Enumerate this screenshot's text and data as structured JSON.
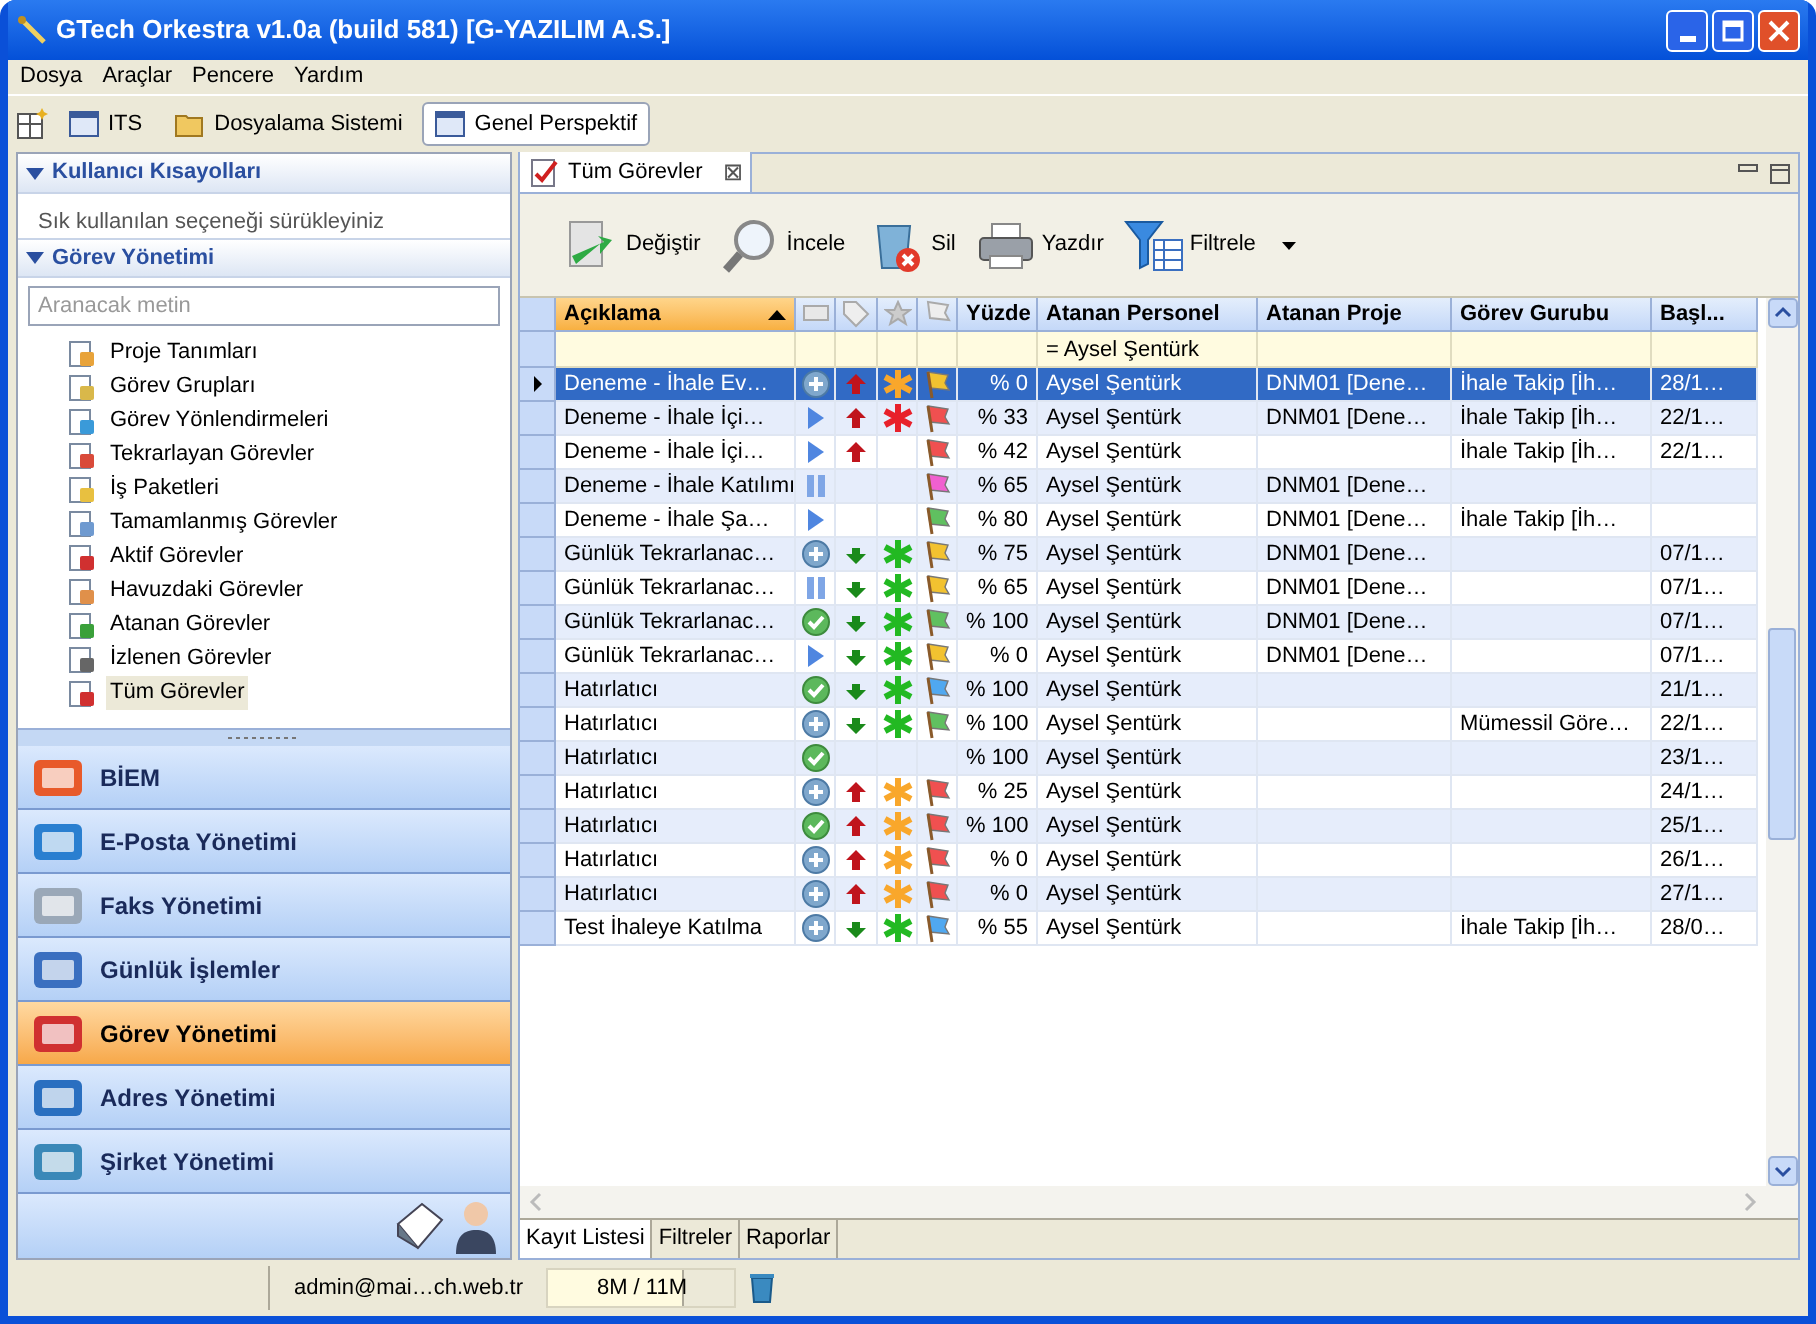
{
  "window": {
    "title": "GTech Orkestra v1.0a (build 581) [G-YAZILIM A.S.]"
  },
  "menu": [
    "Dosya",
    "Araçlar",
    "Pencere",
    "Yardım"
  ],
  "perspectives": [
    {
      "label": "ITS",
      "selected": false
    },
    {
      "label": "Dosyalama Sistemi",
      "selected": false
    },
    {
      "label": "Genel Perspektif",
      "selected": true
    }
  ],
  "sidebar": {
    "shortcuts_title": "Kullanıcı Kısayolları",
    "shortcuts_hint": "Sık kullanılan seçeneği sürükleyiniz",
    "section_title": "Görev Yönetimi",
    "search": {
      "placeholder": "Aranacak metin"
    },
    "items": [
      {
        "label": "Proje Tanımları",
        "selected": false
      },
      {
        "label": "Görev Grupları",
        "selected": false
      },
      {
        "label": "Görev Yönlendirmeleri",
        "selected": false
      },
      {
        "label": "Tekrarlayan Görevler",
        "selected": false
      },
      {
        "label": "İş Paketleri",
        "selected": false
      },
      {
        "label": "Tamamlanmış Görevler",
        "selected": false
      },
      {
        "label": "Aktif Görevler",
        "selected": false
      },
      {
        "label": "Havuzdaki Görevler",
        "selected": false
      },
      {
        "label": "Atanan Görevler",
        "selected": false
      },
      {
        "label": "İzlenen Görevler",
        "selected": false
      },
      {
        "label": "Tüm Görevler",
        "selected": true
      }
    ],
    "modules": [
      {
        "label": "BİEM",
        "selected": false
      },
      {
        "label": "E-Posta Yönetimi",
        "selected": false
      },
      {
        "label": "Faks Yönetimi",
        "selected": false
      },
      {
        "label": "Günlük İşlemler",
        "selected": false
      },
      {
        "label": "Görev Yönetimi",
        "selected": true
      },
      {
        "label": "Adres Yönetimi",
        "selected": false
      },
      {
        "label": "Şirket Yönetimi",
        "selected": false
      }
    ]
  },
  "editor_tab": {
    "title": "Tüm Görevler",
    "close": "⊠"
  },
  "toolbar": [
    {
      "label": "Değiştir",
      "dropdown": false
    },
    {
      "label": "İncele",
      "dropdown": false
    },
    {
      "label": "Sil",
      "dropdown": false
    },
    {
      "label": "Yazdır",
      "dropdown": false
    },
    {
      "label": "Filtrele",
      "dropdown": true
    }
  ],
  "table": {
    "columns": [
      {
        "kind": "text",
        "label": "Açıklama",
        "sorted": true
      },
      {
        "kind": "icon"
      },
      {
        "kind": "icon"
      },
      {
        "kind": "icon"
      },
      {
        "kind": "icon"
      },
      {
        "kind": "text",
        "label": "Yüzde"
      },
      {
        "kind": "text",
        "label": "Atanan Personel",
        "filter": "= Aysel Şentürk"
      },
      {
        "kind": "text",
        "label": "Atanan Proje"
      },
      {
        "kind": "text",
        "label": "Görev Gurubu"
      },
      {
        "kind": "text",
        "label": "Başl..."
      }
    ],
    "rows": [
      {
        "selected": true,
        "desc": "Deneme - İhale Ev…",
        "status": {
          "kind": "new"
        },
        "priority": {
          "kind": "up"
        },
        "importance": {
          "color": "#f9a72b"
        },
        "flag": {
          "color": "#f2c230"
        },
        "percent": "% 0",
        "person": "Aysel Şentürk",
        "project": "DNM01 [Dene…",
        "group": "İhale Takip [İh…",
        "start": "28/1…"
      },
      {
        "selected": false,
        "desc": "Deneme - İhale İçi…",
        "status": {
          "kind": "running"
        },
        "priority": {
          "kind": "up"
        },
        "importance": {
          "color": "#e8202a"
        },
        "flag": {
          "color": "#f05050"
        },
        "percent": "% 33",
        "person": "Aysel Şentürk",
        "project": "DNM01 [Dene…",
        "group": "İhale Takip [İh…",
        "start": "22/1…"
      },
      {
        "selected": false,
        "desc": "Deneme - İhale İçi…",
        "status": {
          "kind": "running"
        },
        "priority": {
          "kind": "up"
        },
        "flag": {
          "color": "#f05050"
        },
        "percent": "% 42",
        "person": "Aysel Şentürk",
        "group": "İhale Takip [İh…",
        "start": "22/1…"
      },
      {
        "selected": false,
        "desc": "Deneme - İhale Katılımı",
        "status": {
          "kind": "paused"
        },
        "flag": {
          "color": "#f060d0"
        },
        "percent": "% 65",
        "person": "Aysel Şentürk",
        "project": "DNM01 [Dene…"
      },
      {
        "selected": false,
        "desc": "Deneme - İhale Şa…",
        "status": {
          "kind": "running"
        },
        "flag": {
          "color": "#60c060"
        },
        "percent": "% 80",
        "person": "Aysel Şentürk",
        "project": "DNM01 [Dene…",
        "group": "İhale Takip [İh…"
      },
      {
        "selected": false,
        "desc": "Günlük Tekrarlanac…",
        "status": {
          "kind": "new"
        },
        "priority": {
          "kind": "down"
        },
        "importance": {
          "color": "#22b922"
        },
        "flag": {
          "color": "#f2c230"
        },
        "percent": "% 75",
        "person": "Aysel Şentürk",
        "project": "DNM01 [Dene…",
        "start": "07/1…"
      },
      {
        "selected": false,
        "desc": "Günlük Tekrarlanac…",
        "status": {
          "kind": "paused"
        },
        "priority": {
          "kind": "down"
        },
        "importance": {
          "color": "#22b922"
        },
        "flag": {
          "color": "#f2c230"
        },
        "percent": "% 65",
        "person": "Aysel Şentürk",
        "project": "DNM01 [Dene…",
        "start": "07/1…"
      },
      {
        "selected": false,
        "desc": "Günlük Tekrarlanac…",
        "status": {
          "kind": "done"
        },
        "priority": {
          "kind": "down"
        },
        "importance": {
          "color": "#22b922"
        },
        "flag": {
          "color": "#60c060"
        },
        "percent": "% 100",
        "person": "Aysel Şentürk",
        "project": "DNM01 [Dene…",
        "start": "07/1…"
      },
      {
        "selected": false,
        "desc": "Günlük Tekrarlanac…",
        "status": {
          "kind": "running"
        },
        "priority": {
          "kind": "down"
        },
        "importance": {
          "color": "#22b922"
        },
        "flag": {
          "color": "#f2c230"
        },
        "percent": "% 0",
        "person": "Aysel Şentürk",
        "project": "DNM01 [Dene…",
        "start": "07/1…"
      },
      {
        "selected": false,
        "desc": "Hatırlatıcı",
        "status": {
          "kind": "done"
        },
        "priority": {
          "kind": "down"
        },
        "importance": {
          "color": "#22b922"
        },
        "flag": {
          "color": "#50a8f0"
        },
        "percent": "% 100",
        "person": "Aysel Şentürk",
        "start": "21/1…"
      },
      {
        "selected": false,
        "desc": "Hatırlatıcı",
        "status": {
          "kind": "new"
        },
        "priority": {
          "kind": "down"
        },
        "importance": {
          "color": "#22b922"
        },
        "flag": {
          "color": "#60c060"
        },
        "percent": "% 100",
        "person": "Aysel Şentürk",
        "group": "Mümessil Göre…",
        "start": "22/1…"
      },
      {
        "selected": false,
        "desc": "Hatırlatıcı",
        "status": {
          "kind": "done"
        },
        "percent": "% 100",
        "person": "Aysel Şentürk",
        "start": "23/1…"
      },
      {
        "selected": false,
        "desc": "Hatırlatıcı",
        "status": {
          "kind": "new"
        },
        "priority": {
          "kind": "up"
        },
        "importance": {
          "color": "#f9a72b"
        },
        "flag": {
          "color": "#f05050"
        },
        "percent": "% 25",
        "person": "Aysel Şentürk",
        "start": "24/1…"
      },
      {
        "selected": false,
        "desc": "Hatırlatıcı",
        "status": {
          "kind": "done"
        },
        "priority": {
          "kind": "up"
        },
        "importance": {
          "color": "#f9a72b"
        },
        "flag": {
          "color": "#f05050"
        },
        "percent": "% 100",
        "person": "Aysel Şentürk",
        "start": "25/1…"
      },
      {
        "selected": false,
        "desc": "Hatırlatıcı",
        "status": {
          "kind": "new"
        },
        "priority": {
          "kind": "up"
        },
        "importance": {
          "color": "#f9a72b"
        },
        "flag": {
          "color": "#f05050"
        },
        "percent": "% 0",
        "person": "Aysel Şentürk",
        "start": "26/1…"
      },
      {
        "selected": false,
        "desc": "Hatırlatıcı",
        "status": {
          "kind": "new"
        },
        "priority": {
          "kind": "up"
        },
        "importance": {
          "color": "#f9a72b"
        },
        "flag": {
          "color": "#f05050"
        },
        "percent": "% 0",
        "person": "Aysel Şentürk",
        "start": "27/1…"
      },
      {
        "selected": false,
        "desc": "Test İhaleye Katılma",
        "status": {
          "kind": "new"
        },
        "priority": {
          "kind": "down"
        },
        "importance": {
          "color": "#22b922"
        },
        "flag": {
          "color": "#50a8f0"
        },
        "percent": "% 55",
        "person": "Aysel Şentürk",
        "group": "İhale Takip [İh…",
        "start": "28/0…"
      }
    ]
  },
  "bottom_tabs": [
    {
      "label": "Kayıt Listesi",
      "selected": true
    },
    {
      "label": "Filtreler",
      "selected": false
    },
    {
      "label": "Raporlar",
      "selected": false
    }
  ],
  "status_bar": {
    "user": "admin@mai…ch.web.tr",
    "memory": {
      "text": "8M / 11M",
      "level": 0.73
    }
  }
}
